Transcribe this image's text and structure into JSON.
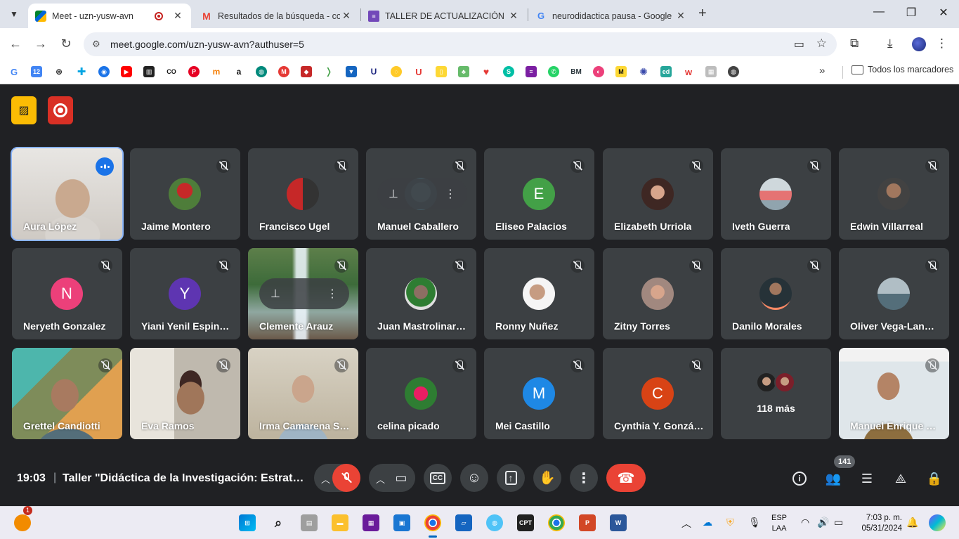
{
  "browser": {
    "tabs": [
      {
        "title": "Meet - uzn-yusw-avn",
        "active": true
      },
      {
        "title": "Resultados de la búsqueda - co",
        "active": false
      },
      {
        "title": "TALLER DE ACTUALIZACIÓN EN",
        "active": false
      },
      {
        "title": "neurodidactica pausa - Google",
        "active": false
      }
    ],
    "url": "meet.google.com/uzn-yusw-avn?authuser=5",
    "bookmarks_folder": "Todos los marcadores"
  },
  "meet": {
    "participants": [
      {
        "name": "Aura López",
        "speaking": true
      },
      {
        "name": "Jaime Montero"
      },
      {
        "name": "Francisco Ugel"
      },
      {
        "name": "Manuel Caballero"
      },
      {
        "name": "Eliseo Palacios",
        "initial": "E",
        "color": "#43a047"
      },
      {
        "name": "Elizabeth Urriola"
      },
      {
        "name": "Iveth Guerra"
      },
      {
        "name": "Edwin Villarreal"
      },
      {
        "name": "Neryeth Gonzalez",
        "initial": "N",
        "color": "#ec407a"
      },
      {
        "name": "Yiani Yenil Espin…",
        "initial": "Y",
        "color": "#5e35b1"
      },
      {
        "name": "Clemente Arauz"
      },
      {
        "name": "Juan Mastrolinar…"
      },
      {
        "name": "Ronny Nuñez"
      },
      {
        "name": "Zitny Torres"
      },
      {
        "name": "Danilo Morales"
      },
      {
        "name": "Oliver Vega-Lan…"
      },
      {
        "name": "Grettel Candiotti"
      },
      {
        "name": "Eva Ramos"
      },
      {
        "name": "Irma Camarena S…"
      },
      {
        "name": "celina picado"
      },
      {
        "name": "Mei Castillo",
        "initial": "M",
        "color": "#1e88e5"
      },
      {
        "name": "Cynthia Y. Gonzá…",
        "initial": "C",
        "color": "#d84315"
      },
      {
        "name": "Manuel Enrique …"
      }
    ],
    "more_label": "118 más",
    "time": "19:03",
    "meeting_title": "Taller \"Didáctica de la Investigación: Estratégias...",
    "participant_count": "141"
  },
  "taskbar": {
    "notification_count": "1",
    "language_line1": "ESP",
    "language_line2": "LAA",
    "clock_time": "7:03 p. m.",
    "clock_date": "05/31/2024"
  }
}
